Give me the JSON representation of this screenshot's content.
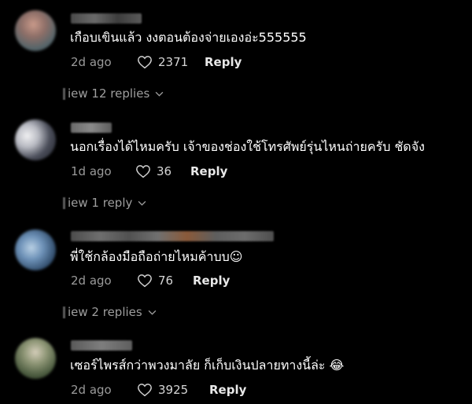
{
  "comments": [
    {
      "text": "เกือบเขินแล้ว งงตอนต้องจ่ายเองอ่ะ555555",
      "time": "2d ago",
      "likes": "2371",
      "reply_label": "Reply",
      "view_replies": "iew 12 replies",
      "avatar_colors": [
        "#b58a7c",
        "#6f8f84",
        "#3a4a52"
      ]
    },
    {
      "text": "นอกเรื่องได้ไหมครับ เจ้าของช่องใช้โทรศัพย์รุ่นไหนถ่ายครับ ชัดจัง",
      "time": "1d ago",
      "likes": "36",
      "reply_label": "Reply",
      "view_replies": "iew 1 reply",
      "avatar_colors": [
        "#d9d9dc",
        "#2c2f3a",
        "#8b8e99"
      ]
    },
    {
      "text": "พี่ใช้กล้องมือถือถ่ายไหมค้าบบ☺",
      "time": "2d ago",
      "likes": "76",
      "reply_label": "Reply",
      "view_replies": "iew 2 replies",
      "avatar_colors": [
        "#5f84b0",
        "#a8c1d6",
        "#2f4560"
      ]
    },
    {
      "text": "เซอร์ไพรส์กว่าพวงมาลัย ก็เก็บเงินปลายทางนี้ล่ะ 😂",
      "time": "2d ago",
      "likes": "3925",
      "reply_label": "Reply",
      "view_replies": "",
      "avatar_colors": [
        "#7f8a6b",
        "#c9c2b0",
        "#3d4a35"
      ]
    }
  ],
  "icons": {
    "like": "heart-outline-icon",
    "expand": "chevron-down-icon"
  }
}
